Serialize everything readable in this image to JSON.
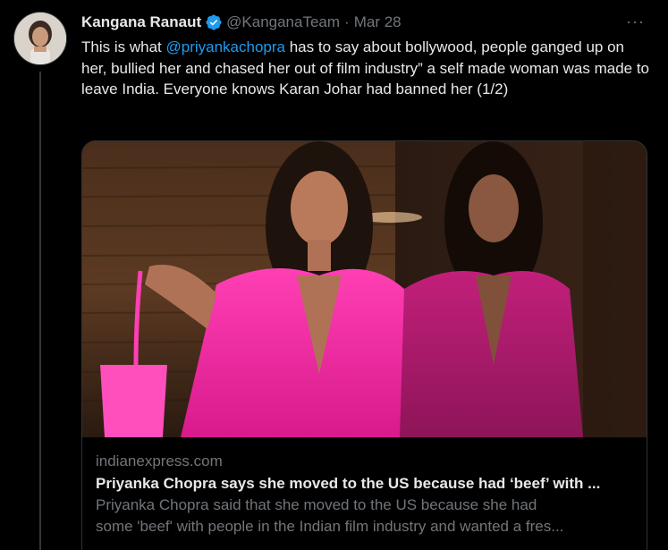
{
  "author": {
    "display_name": "Kangana Ranaut",
    "handle": "@KanganaTeam",
    "separator": "·",
    "date": "Mar 28",
    "verified": true
  },
  "tweet": {
    "text_before_mention": "This is what ",
    "mention": "@priyankachopra",
    "text_after_mention": " has to say about bollywood, people ganged up on her, bullied her and chased her out of film industry” a self made woman was made to leave India. Everyone knows Karan Johar had banned her (1/2)"
  },
  "menu": {
    "more_label": "···"
  },
  "card": {
    "domain": "indianexpress.com",
    "title": "Priyanka Chopra says she moved to the US because had ‘beef’ with ...",
    "description_line1": "Priyanka Chopra said that she moved to the US because she had",
    "description_line2": "some 'beef' with people in the Indian film industry and wanted a fres..."
  },
  "colors": {
    "background": "#000000",
    "text_primary": "#e7e9ea",
    "text_secondary": "#71767b",
    "link": "#1d9bf0",
    "verified_badge": "#1d9bf0",
    "border": "#2f3336"
  },
  "icons": {
    "verified": "verified-badge-icon",
    "more": "more-options-icon"
  }
}
